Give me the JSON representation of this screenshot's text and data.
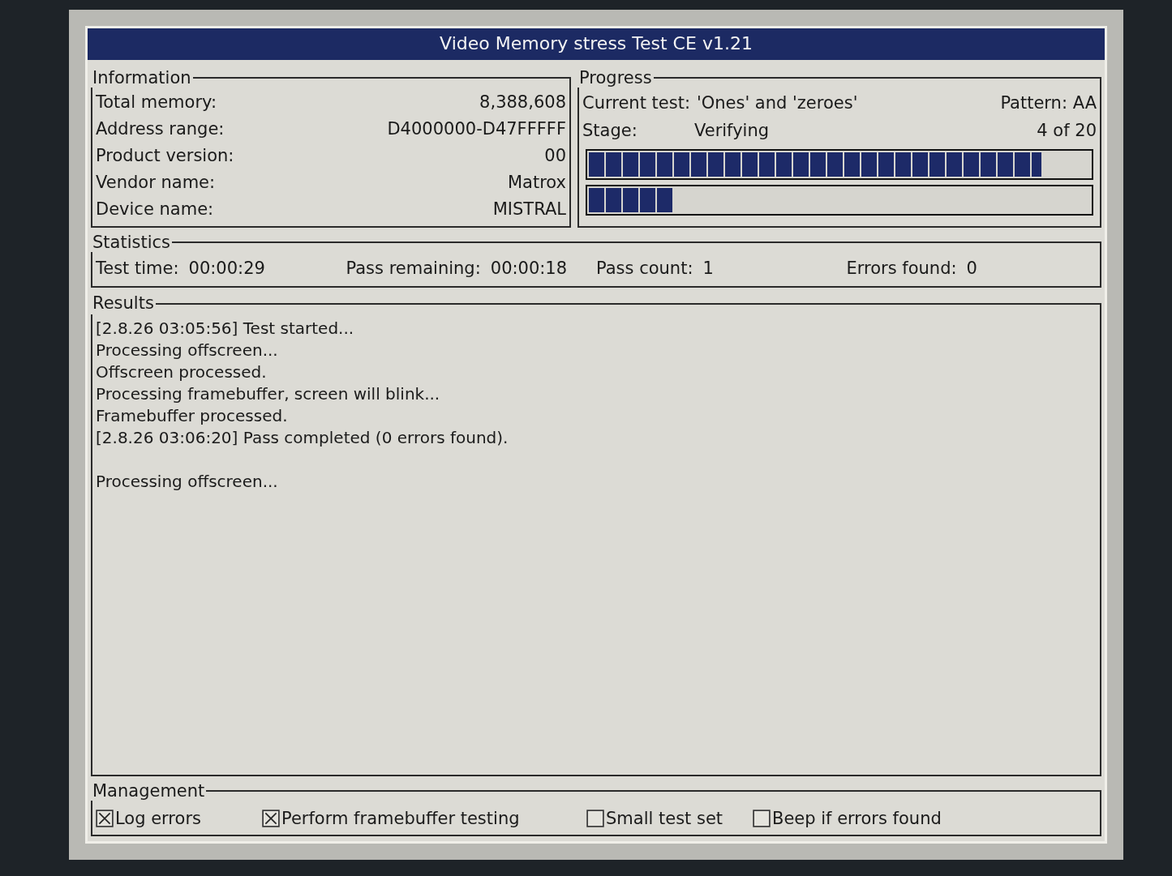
{
  "window": {
    "title": "Video Memory stress Test CE v1.21"
  },
  "information": {
    "title": "Information",
    "rows": [
      {
        "label": "Total memory:",
        "value": "8,388,608"
      },
      {
        "label": "Address range:",
        "value": "D4000000-D47FFFFF"
      },
      {
        "label": "Product version:",
        "value": "00"
      },
      {
        "label": "Vendor name:",
        "value": "Matrox"
      },
      {
        "label": "Device name:",
        "value": "MISTRAL"
      }
    ]
  },
  "progress": {
    "title": "Progress",
    "current_test_label": "Current test:",
    "current_test": "'Ones' and 'zeroes'",
    "pattern": "Pattern: AA",
    "stage_label": "Stage:",
    "stage": "Verifying",
    "step": "4 of 20",
    "bars": [
      {
        "level": 0.9
      },
      {
        "level": 0.17
      }
    ]
  },
  "statistics": {
    "title": "Statistics",
    "items": [
      {
        "label": "Test time:",
        "value": "00:00:29"
      },
      {
        "label": "Pass remaining:",
        "value": "00:00:18"
      },
      {
        "label": "Pass count:",
        "value": "1"
      },
      {
        "label": "Errors found:",
        "value": "0"
      }
    ]
  },
  "results": {
    "title": "Results",
    "paragraphs": [
      {
        "lines": [
          "[2.8.26 03:05:56] Test started...",
          "Processing offscreen...",
          "Offscreen processed.",
          "Processing framebuffer, screen will blink...",
          "Framebuffer processed.",
          "[2.8.26 03:06:20] Pass completed (0 errors found)."
        ]
      },
      {
        "lines": [
          "Processing offscreen..."
        ]
      }
    ]
  },
  "management": {
    "title": "Management",
    "options": [
      {
        "label": "Log errors",
        "checked": true
      },
      {
        "label": "Perform framebuffer testing",
        "checked": true
      },
      {
        "label": "Small test set",
        "checked": false
      },
      {
        "label": "Beep if errors found",
        "checked": false
      }
    ]
  }
}
